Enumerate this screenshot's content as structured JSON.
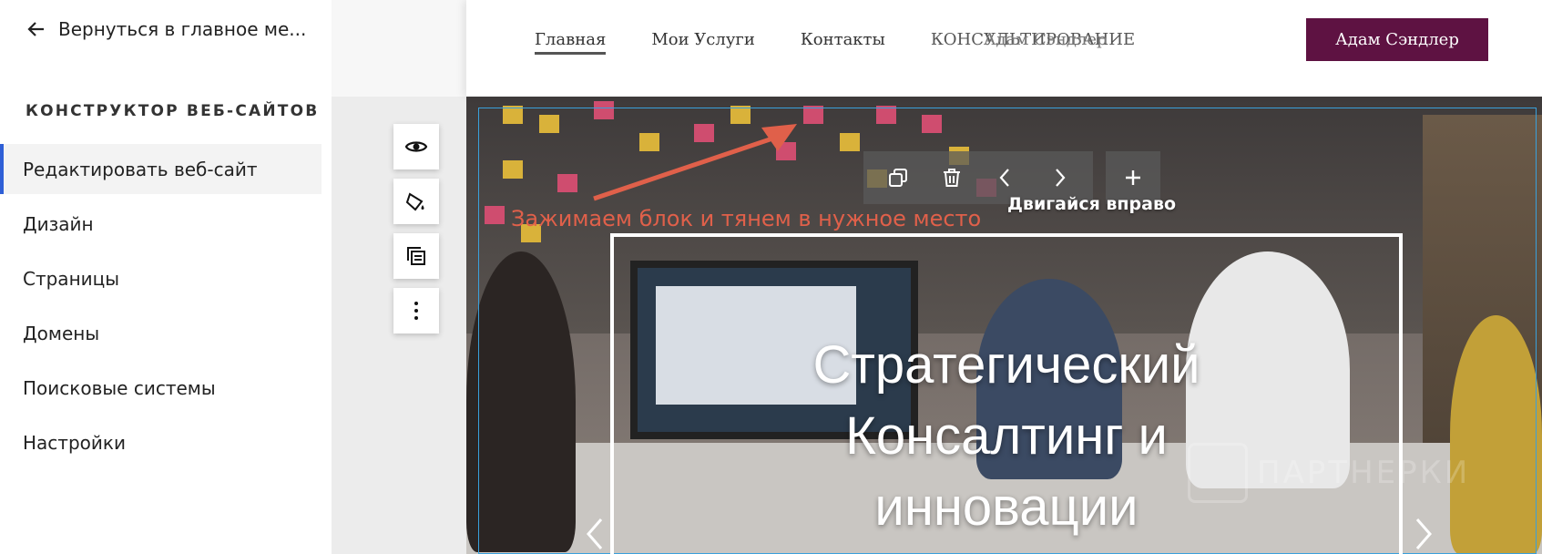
{
  "sidebar": {
    "back_label": "Вернуться в главное ме...",
    "title": "КОНСТРУКТОР ВЕБ-САЙТОВ",
    "items": [
      {
        "label": "Редактировать веб-сайт",
        "active": true
      },
      {
        "label": "Дизайн"
      },
      {
        "label": "Страницы"
      },
      {
        "label": "Домены"
      },
      {
        "label": "Поисковые системы"
      },
      {
        "label": "Настройки"
      }
    ]
  },
  "tools": [
    "eye-icon",
    "paint-bucket-icon",
    "copy-page-icon",
    "more-vertical-icon"
  ],
  "site": {
    "nav": [
      "Главная",
      "Мои Услуги",
      "Контакты"
    ],
    "nav_overlap_a": "КОНСУЛЬТИРОВАНИЕ",
    "nav_overlap_b": "Адам Сэндлер",
    "cta": "Адам Сэндлер"
  },
  "block_toolbar": {
    "icons": [
      "duplicate-icon",
      "trash-icon",
      "chevron-left-icon",
      "chevron-right-icon",
      "plus-icon"
    ],
    "tooltip": "Двигайся вправо"
  },
  "annotation": "Зажимаем блок и тянем в нужное место",
  "hero": {
    "title_lines": [
      "Стратегический",
      "Консалтинг и",
      "инновации"
    ]
  },
  "watermark": "ПАРТНЕРКИ",
  "colors": {
    "accent": "#5e1242",
    "selection": "#39a0dc",
    "active_nav": "#2f5fd6",
    "annotation": "#e0604a"
  }
}
